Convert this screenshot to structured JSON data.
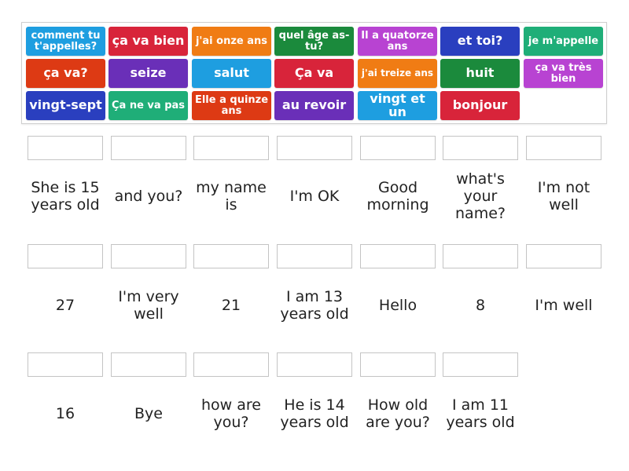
{
  "tiles": [
    {
      "text": "comment tu t'appelles?",
      "color": "#1e9ee0",
      "size": "mid",
      "row": 0,
      "col": 0
    },
    {
      "text": "ça va bien",
      "color": "#d8243a",
      "size": "big",
      "row": 0,
      "col": 1
    },
    {
      "text": "j'ai onze ans",
      "color": "#f07c14",
      "size": "mid",
      "row": 0,
      "col": 2
    },
    {
      "text": "quel âge as-tu?",
      "color": "#1b8a3c",
      "size": "mid",
      "row": 0,
      "col": 3
    },
    {
      "text": "Il a quatorze ans",
      "color": "#b843d2",
      "size": "mid",
      "row": 0,
      "col": 4
    },
    {
      "text": "et toi?",
      "color": "#2a3fbf",
      "size": "big",
      "row": 0,
      "col": 5
    },
    {
      "text": "je m'appelle",
      "color": "#1fae78",
      "size": "mid",
      "row": 0,
      "col": 6
    },
    {
      "text": "ça va?",
      "color": "#dd3a14",
      "size": "big",
      "row": 1,
      "col": 0
    },
    {
      "text": "seize",
      "color": "#6a2fb8",
      "size": "big",
      "row": 1,
      "col": 1
    },
    {
      "text": "salut",
      "color": "#1e9ee0",
      "size": "big",
      "row": 1,
      "col": 2
    },
    {
      "text": "Ça va",
      "color": "#d8243a",
      "size": "big",
      "row": 1,
      "col": 3
    },
    {
      "text": "j'ai treize ans",
      "color": "#f07c14",
      "size": "small",
      "row": 1,
      "col": 4
    },
    {
      "text": "huit",
      "color": "#1b8a3c",
      "size": "big",
      "row": 1,
      "col": 5
    },
    {
      "text": "ça va très bien",
      "color": "#b843d2",
      "size": "mid",
      "row": 1,
      "col": 6
    },
    {
      "text": "vingt-sept",
      "color": "#2a3fbf",
      "size": "big",
      "row": 2,
      "col": 0
    },
    {
      "text": "Ça ne va pas",
      "color": "#1fae78",
      "size": "mid",
      "row": 2,
      "col": 1
    },
    {
      "text": "Elle a quinze ans",
      "color": "#dd3a14",
      "size": "mid",
      "row": 2,
      "col": 2
    },
    {
      "text": "au revoir",
      "color": "#6a2fb8",
      "size": "big",
      "row": 2,
      "col": 3
    },
    {
      "text": "vingt et un",
      "color": "#1e9ee0",
      "size": "big",
      "row": 2,
      "col": 4
    },
    {
      "text": "bonjour",
      "color": "#d8243a",
      "size": "big",
      "row": 2,
      "col": 5
    }
  ],
  "prompts": [
    [
      "She is 15 years old",
      "and you?",
      "my name is",
      "I'm OK",
      "Good morning",
      "what's your name?",
      "I'm not well"
    ],
    [
      "27",
      "I'm very well",
      "21",
      "I am 13 years old",
      "Hello",
      "8",
      "I'm well"
    ],
    [
      "16",
      "Bye",
      "how are you?",
      "He is 14 years old",
      "How old are you?",
      "I am 11 years old"
    ]
  ]
}
